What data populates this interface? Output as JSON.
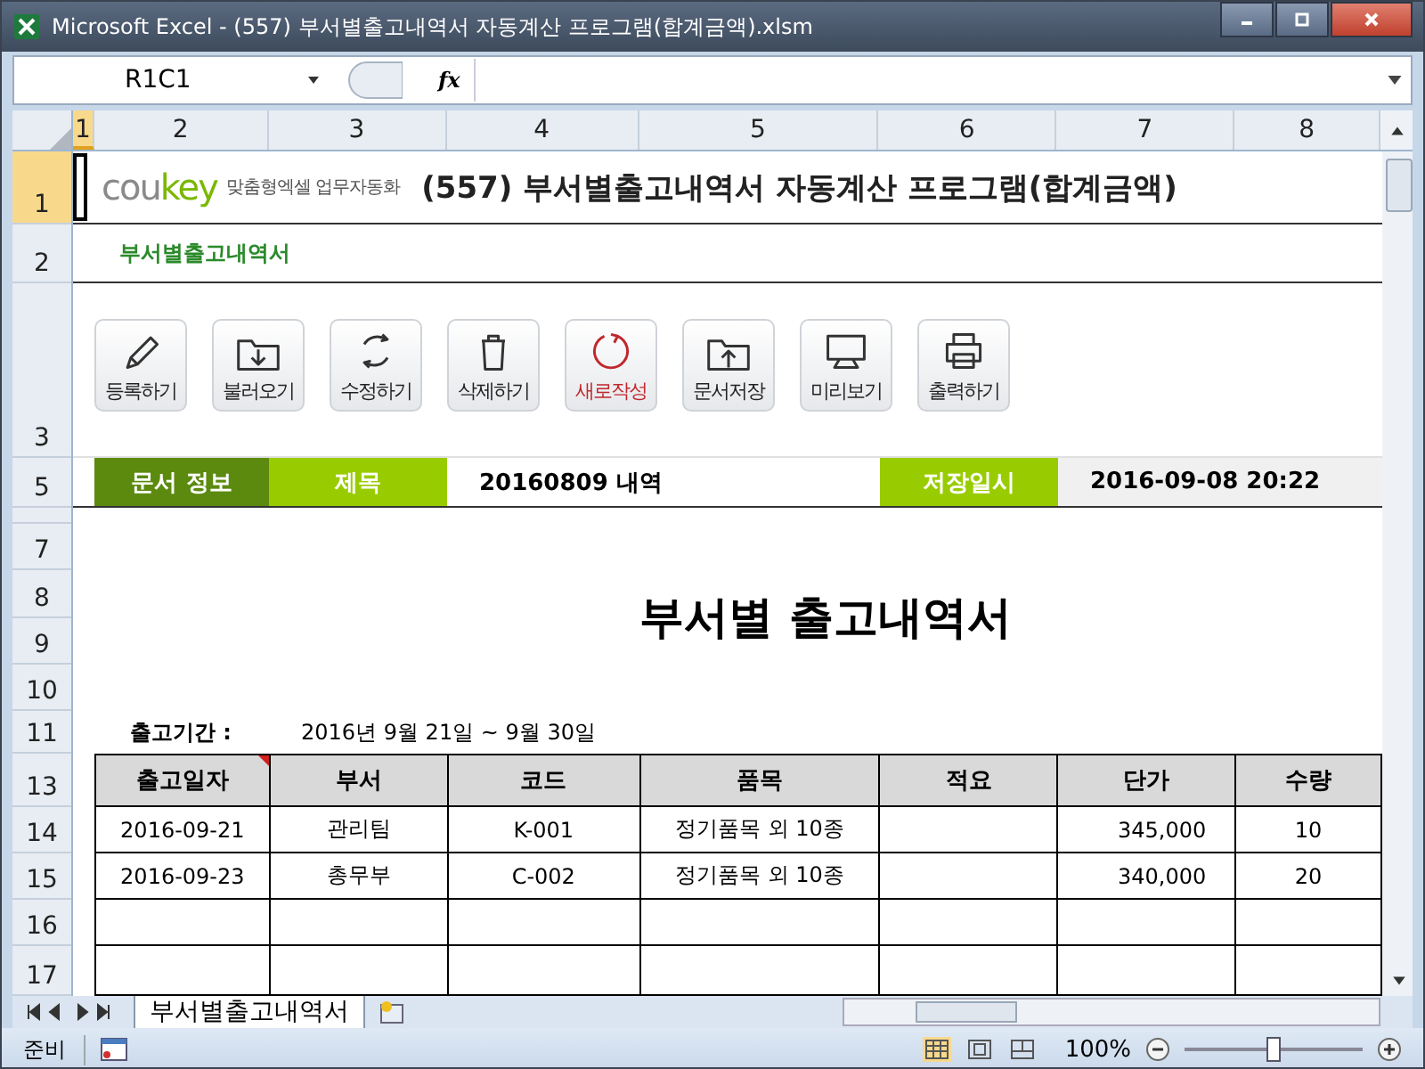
{
  "window": {
    "title": "Microsoft Excel - (557) 부서별출고내역서 자동계산 프로그램(합계금액).xlsm"
  },
  "formula_bar": {
    "name_box": "R1C1",
    "fx": "fx"
  },
  "column_headers": [
    {
      "label": "1",
      "selected": true
    },
    {
      "label": "2",
      "selected": false
    },
    {
      "label": "3",
      "selected": false
    },
    {
      "label": "4",
      "selected": false
    },
    {
      "label": "5",
      "selected": false
    },
    {
      "label": "6",
      "selected": false
    },
    {
      "label": "7",
      "selected": false
    },
    {
      "label": "8",
      "selected": false
    }
  ],
  "row_headers": [
    {
      "label": "1",
      "selected": true
    },
    {
      "label": "2",
      "selected": false
    },
    {
      "label": "3",
      "selected": false
    },
    {
      "label": "5",
      "selected": false
    },
    {
      "label": "7",
      "selected": false
    },
    {
      "label": "8",
      "selected": false
    },
    {
      "label": "9",
      "selected": false
    },
    {
      "label": "10",
      "selected": false
    },
    {
      "label": "11",
      "selected": false
    },
    {
      "label": "13",
      "selected": false
    },
    {
      "label": "14",
      "selected": false
    },
    {
      "label": "15",
      "selected": false
    },
    {
      "label": "16",
      "selected": false
    },
    {
      "label": "17",
      "selected": false
    }
  ],
  "banner": {
    "logo_grey": "cou",
    "logo_green": "key",
    "tagline": "맞춤형엑셀 업무자동화",
    "title": "(557) 부서별출고내역서 자동계산 프로그램(합계금액)"
  },
  "subtitle": "부서별출고내역서",
  "toolbar": [
    {
      "label": "등록하기",
      "kind": "pencil",
      "accent": false
    },
    {
      "label": "불러오기",
      "kind": "folder-down",
      "accent": false
    },
    {
      "label": "수정하기",
      "kind": "refresh",
      "accent": false
    },
    {
      "label": "삭제하기",
      "kind": "trash",
      "accent": false
    },
    {
      "label": "새로작성",
      "kind": "circle-arrow",
      "accent": true
    },
    {
      "label": "문서저장",
      "kind": "folder-up",
      "accent": false
    },
    {
      "label": "미리보기",
      "kind": "monitor",
      "accent": false
    },
    {
      "label": "출력하기",
      "kind": "printer",
      "accent": false
    }
  ],
  "info_bar": {
    "section": "문서 정보",
    "title_label": "제목",
    "title_value": "20160809 내역",
    "saved_label": "저장일시",
    "saved_value": "2016-09-08 20:22"
  },
  "heading": "부서별 출고내역서",
  "period": {
    "label": "출고기간 :",
    "value": "2016년 9월 21일 ~ 9월 30일"
  },
  "table": {
    "columns": [
      "출고일자",
      "부서",
      "코드",
      "품목",
      "적요",
      "단가",
      "수량"
    ],
    "rows": [
      [
        "2016-09-21",
        "관리팀",
        "K-001",
        "정기품목 외 10종",
        "",
        "345,000",
        "10"
      ],
      [
        "2016-09-23",
        "총무부",
        "C-002",
        "정기품목 외 10종",
        "",
        "340,000",
        "20"
      ],
      [
        "",
        "",
        "",
        "",
        "",
        "",
        ""
      ],
      [
        "",
        "",
        "",
        "",
        "",
        "",
        ""
      ]
    ]
  },
  "sheet_tabs": [
    {
      "label": "부서별출고내역서",
      "selected": true
    }
  ],
  "status_bar": {
    "mode": "준비",
    "zoom": "100%",
    "zoom_slider": {
      "level": 0.5
    }
  }
}
